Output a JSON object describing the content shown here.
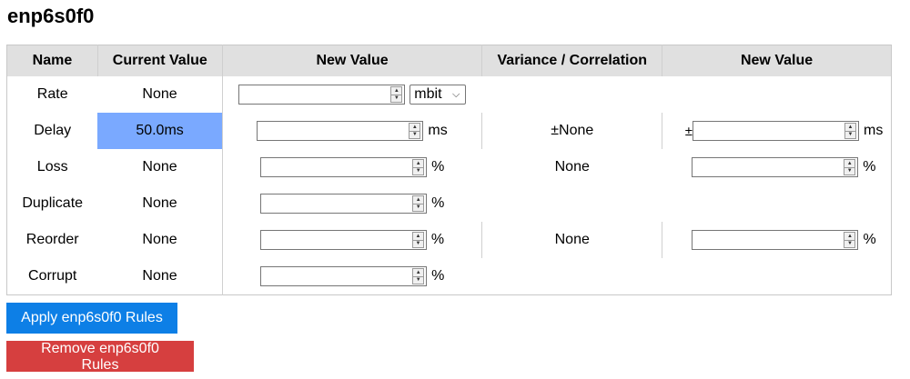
{
  "page": {
    "title": "enp6s0f0"
  },
  "table": {
    "headers": [
      "Name",
      "Current Value",
      "New Value",
      "Variance / Correlation",
      "New Value"
    ],
    "rows": [
      {
        "name": "Rate",
        "current": "None",
        "unit": "",
        "select": "mbit"
      },
      {
        "name": "Delay",
        "current": "50.0ms",
        "unit": "ms",
        "variance": "±None",
        "var_prefix": "±",
        "var_unit": "ms"
      },
      {
        "name": "Loss",
        "current": "None",
        "unit": "%",
        "variance": "None",
        "var_unit": "%"
      },
      {
        "name": "Duplicate",
        "current": "None",
        "unit": "%"
      },
      {
        "name": "Reorder",
        "current": "None",
        "unit": "%",
        "variance": "None",
        "var_unit": "%"
      },
      {
        "name": "Corrupt",
        "current": "None",
        "unit": "%"
      }
    ]
  },
  "buttons": {
    "apply": "Apply enp6s0f0 Rules",
    "remove": "Remove enp6s0f0 Rules"
  },
  "colors": {
    "highlight": "#7aa9ff",
    "apply": "#0d7fe6",
    "remove": "#d63f3f",
    "header_bg": "#e0e0e0"
  },
  "icons": {
    "spinner": "spin-arrows-icon",
    "select": "chevron-down-icon"
  }
}
